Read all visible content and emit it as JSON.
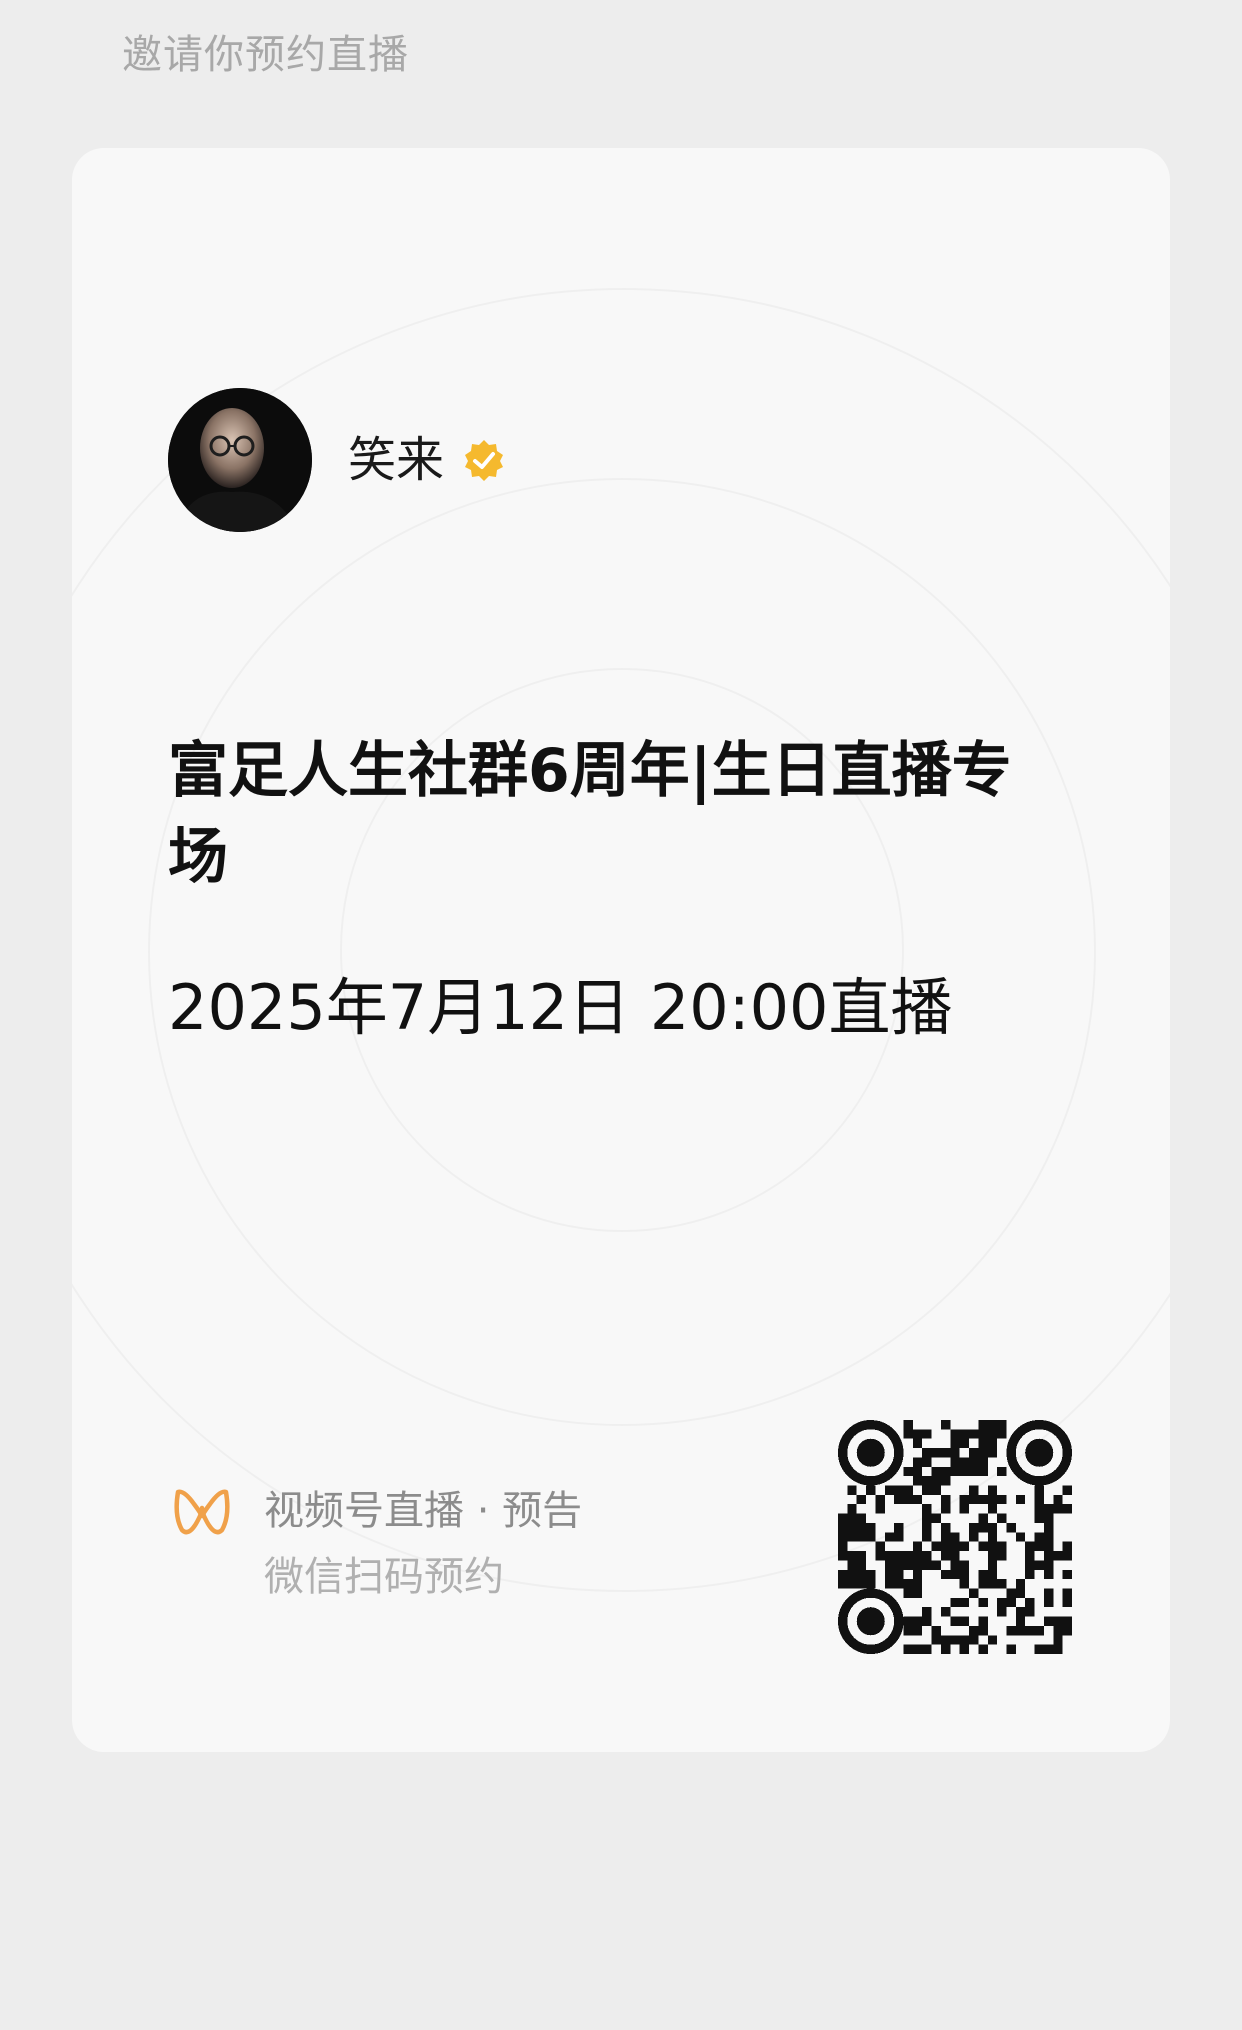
{
  "header": {
    "title": "邀请你预约直播"
  },
  "card": {
    "author": {
      "name": "笑来",
      "avatar_icon": "avatar-portrait",
      "verified_icon": "verified-badge-icon",
      "verified_color": "#f5b92e"
    },
    "live": {
      "title": "富足人生社群6周年|生日直播专场",
      "time": "2025年7月12日  20:00直播"
    },
    "footer": {
      "logo_icon": "channels-logo-icon",
      "logo_color": "#f0a14a",
      "source": "视频号直播 · 预告",
      "action": "微信扫码预约"
    },
    "qr_code_icon": "qr-code"
  }
}
